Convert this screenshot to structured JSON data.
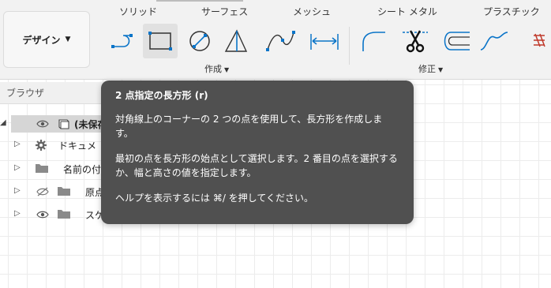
{
  "ribbon": {
    "tabs": [
      "ソリッド",
      "サーフェス",
      "メッシュ",
      "シート メタル",
      "プラスチック"
    ],
    "workspace_button": {
      "label": "デザイン",
      "caret": "▼"
    },
    "groups": {
      "create": {
        "label": "作成",
        "caret": "▼"
      },
      "modify": {
        "label": "修正",
        "caret": "▼"
      }
    },
    "tools_create": [
      "line-icon",
      "rectangle-icon",
      "circle-icon",
      "triangle-icon",
      "spline-icon",
      "dimension-icon"
    ],
    "tools_modify": [
      "fillet-icon",
      "trim-scissors-icon",
      "offset-icon",
      "curve-icon",
      "hatch-icon"
    ],
    "accent_color": "#0a74c8",
    "modify_accent_color": "#c0392b"
  },
  "browser": {
    "title": "ブラウザ",
    "items": [
      {
        "label": "(未保存",
        "icon": "component-icon"
      },
      {
        "label": "ドキュメ",
        "icon": "gear-icon"
      },
      {
        "label": "名前の付",
        "icon": "folder-icon"
      },
      {
        "label": "原点",
        "icon": "folder-icon"
      },
      {
        "label": "スケ",
        "icon": "folder-icon"
      }
    ]
  },
  "tooltip": {
    "title": "2 点指定の長方形 (r)",
    "line1": "対角線上のコーナーの 2 つの点を使用して、長方形を作成します。",
    "line2": "最初の点を長方形の始点として選択します。2 番目の点を選択するか、幅と高さの値を指定します。",
    "hint": "ヘルプを表示するには ⌘/ を押してください。"
  }
}
